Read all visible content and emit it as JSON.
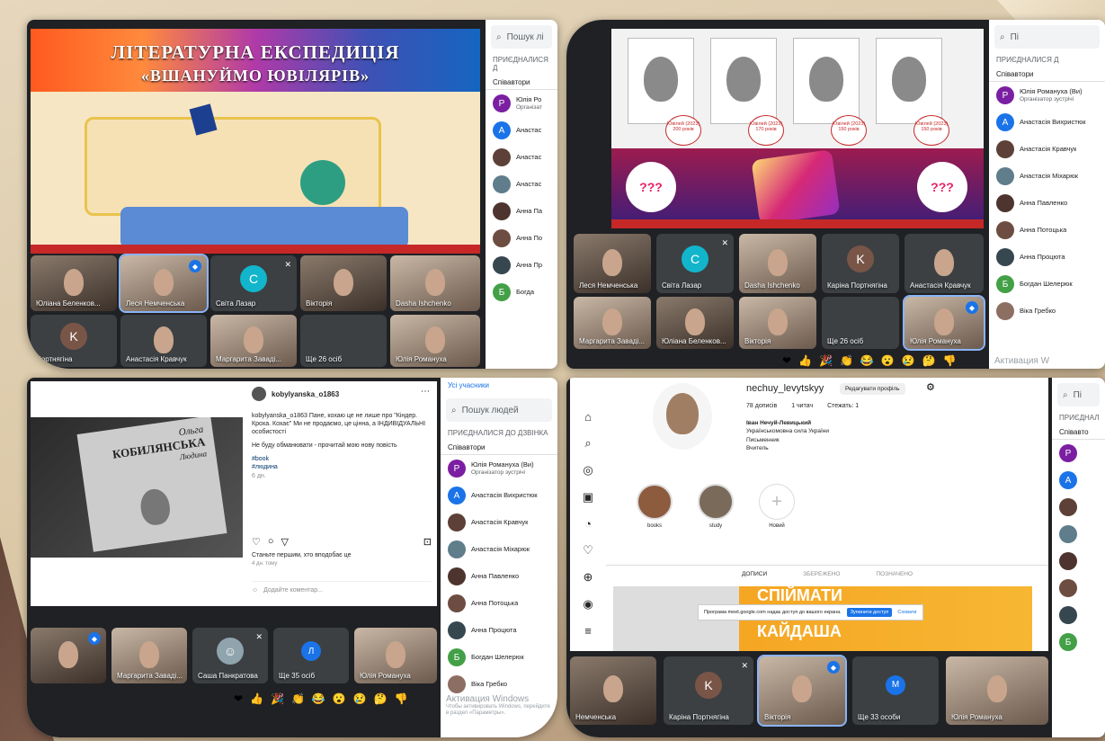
{
  "panel1": {
    "slide_title_line1": "ЛІТЕРАТУРНА ЕКСПЕДИЦІЯ",
    "slide_title_line2": "«ВШАНУЙМО ЮВІЛЯРІВ»",
    "search_placeholder": "Пошук лі",
    "section_joined": "ПРИЄДНАЛИСЯ Д",
    "tab_coauthors": "Співавтори",
    "participants": [
      {
        "name": "Юлія Ро",
        "sub": "Організат",
        "avatar": "P",
        "color": "#7b1fa2"
      },
      {
        "name": "Анастас",
        "sub": "",
        "avatar": "A",
        "color": "#1a73e8"
      },
      {
        "name": "Анастас",
        "sub": "",
        "avatar": "",
        "color": "#5d4037"
      },
      {
        "name": "Анастас",
        "sub": "",
        "avatar": "",
        "color": "#607d8b"
      },
      {
        "name": "Анна Па",
        "sub": "",
        "avatar": "",
        "color": "#4e342e"
      },
      {
        "name": "Анна По",
        "sub": "",
        "avatar": "",
        "color": "#6d4c41"
      },
      {
        "name": "Анна Пр",
        "sub": "",
        "avatar": "",
        "color": "#37474f"
      },
      {
        "name": "Богда",
        "sub": "",
        "avatar": "Б",
        "color": "#43a047"
      }
    ],
    "tiles": [
      {
        "name": "Юліана Беленков..."
      },
      {
        "name": "Леся Немченська"
      },
      {
        "name": "Світа Лазар",
        "avatar": "C"
      },
      {
        "name": "Вікторія"
      },
      {
        "name": "Dasha Ishchenko"
      },
      {
        "name": "Портнягіна",
        "avatar": "K"
      },
      {
        "name": "Анастасія Кравчук"
      },
      {
        "name": "Маргарита Заваді..."
      },
      {
        "name": "Ще 26 осіб"
      },
      {
        "name": "Юлія Романуха"
      }
    ]
  },
  "panel2": {
    "search_placeholder": "Пі",
    "section_joined": "ПРИЄДНАЛИСЯ Д",
    "tab_coauthors": "Співавтори",
    "badges": [
      "Ювілей (2023) 200 років",
      "Ювілей (2023) 170 років",
      "Ювілей (2023) 150 років",
      "Ювілей (2023) 150 років"
    ],
    "participants": [
      {
        "name": "Юлія Романуха (Ви)",
        "sub": "Організатор зустрічі",
        "avatar": "P",
        "color": "#7b1fa2"
      },
      {
        "name": "Анастасія Вихристюк",
        "sub": "",
        "avatar": "A",
        "color": "#1a73e8"
      },
      {
        "name": "Анастасія Кравчук",
        "sub": "",
        "avatar": "",
        "color": "#5d4037"
      },
      {
        "name": "Анастасія Міхарюк",
        "sub": "",
        "avatar": "",
        "color": "#607d8b"
      },
      {
        "name": "Анна Павленко",
        "sub": "",
        "avatar": "",
        "color": "#4e342e"
      },
      {
        "name": "Анна Потоцька",
        "sub": "",
        "avatar": "",
        "color": "#6d4c41"
      },
      {
        "name": "Анна Процюта",
        "sub": "",
        "avatar": "",
        "color": "#37474f"
      },
      {
        "name": "Богдан Шелерюк",
        "sub": "",
        "avatar": "Б",
        "color": "#43a047"
      },
      {
        "name": "Віка Гребко",
        "sub": "",
        "avatar": "",
        "color": "#8d6e63"
      }
    ],
    "tiles": [
      {
        "name": "Леся Немченська"
      },
      {
        "name": "Світа Лазар",
        "avatar": "C"
      },
      {
        "name": "Dasha Ishchenko"
      },
      {
        "name": "Каріна Портнягіна",
        "avatar": "K"
      },
      {
        "name": "Анастасія Кравчук"
      },
      {
        "name": "Маргарита Заваді..."
      },
      {
        "name": "Юліана Беленков..."
      },
      {
        "name": "Вікторія"
      },
      {
        "name": "Ще 26 осіб"
      },
      {
        "name": "Юлія Романуха"
      }
    ],
    "windows_activation": "Активация W"
  },
  "panel3": {
    "ig_username": "kobylyanska_o1863",
    "post_caption": "kobylyanska_o1863 Пане, кохаю це не лише про \"Кіндер. Кроха. Кохає\" Ми не продаємо, це цінна, а ІНДИВІДУАЛЬНІ особистості",
    "post_line2": "Не буду обманювати - прочитай мою нову повість",
    "hashtag1": "#book",
    "hashtag2": "#людина",
    "time": "6 дн.",
    "likes_prompt": "Станьте першим, хто вподобає це",
    "date": "4 дн. тому",
    "comment_placeholder": "Додайте коментар...",
    "book_author": "Ольга",
    "book_title_line1": "КОБИЛЯНСЬКА",
    "book_title_line2": "Людина",
    "top_partial": "Усі учасники",
    "search_placeholder": "Пошук людей",
    "section_joined": "ПРИЄДНАЛИСЯ ДО ДЗВІНКА",
    "tab_coauthors": "Співавтори",
    "participants": [
      {
        "name": "Юлія Романуха (Ви)",
        "sub": "Організатор зустрічі",
        "avatar": "P",
        "color": "#7b1fa2"
      },
      {
        "name": "Анастасія Вихристюк",
        "sub": "",
        "avatar": "A",
        "color": "#1a73e8"
      },
      {
        "name": "Анастасія Кравчук",
        "sub": "",
        "avatar": "",
        "color": "#5d4037"
      },
      {
        "name": "Анастасія Міхарюк",
        "sub": "",
        "avatar": "",
        "color": "#607d8b"
      },
      {
        "name": "Анна Павленко",
        "sub": "",
        "avatar": "",
        "color": "#4e342e"
      },
      {
        "name": "Анна Потоцька",
        "sub": "",
        "avatar": "",
        "color": "#6d4c41"
      },
      {
        "name": "Анна Процюта",
        "sub": "",
        "avatar": "",
        "color": "#37474f"
      },
      {
        "name": "Богдан Шелерюк",
        "sub": "",
        "avatar": "Б",
        "color": "#43a047"
      },
      {
        "name": "Віка Гребко",
        "sub": "",
        "avatar": "",
        "color": "#8d6e63"
      }
    ],
    "tiles": [
      {
        "name": ""
      },
      {
        "name": "Маргарита Заваді..."
      },
      {
        "name": "Саша Панкратова"
      },
      {
        "name": "Ще 35 осіб"
      },
      {
        "name": "Юлія Романуха"
      }
    ],
    "windows_activation": "Активация Windows",
    "windows_activation_sub": "Чтобы активировать Windows, перейдите в раздел «Параметры»."
  },
  "panel4": {
    "profile_username": "nechuy_levytskyy",
    "edit_profile": "Редагувати профіль",
    "posts_count": "78 дописів",
    "followers": "1 читач",
    "following": "Стежать: 1",
    "full_name": "Іван Нечуй-Левицький",
    "bio1": "Українськомовна сила України",
    "bio2": "Письменник",
    "bio3": "Вчитель",
    "highlight1": "books",
    "highlight2": "study",
    "highlight_new": "Новий",
    "tab_posts": "ДОПИСИ",
    "tab_saved": "ЗБЕРЕЖЕНО",
    "tab_tagged": "ПОЗНАЧЕНО",
    "banner_line1": "СПІЙМАТИ",
    "banner_line2": "КАЙДАША",
    "screen_share_notice": "Програма meet.google.com надає доступ до вашого екрана.",
    "stop_sharing": "Зупинити доступ",
    "hide": "Сховати",
    "search_placeholder": "Пі",
    "section_joined": "ПРИЄДНАЛ",
    "tab_coauthors": "Співавто",
    "tiles": [
      {
        "name": "Немченська"
      },
      {
        "name": "Каріна Портнягіна",
        "avatar": "K"
      },
      {
        "name": "Вікторія"
      },
      {
        "name": "Ще 33 особи"
      },
      {
        "name": "Юлія Романуха"
      }
    ]
  }
}
